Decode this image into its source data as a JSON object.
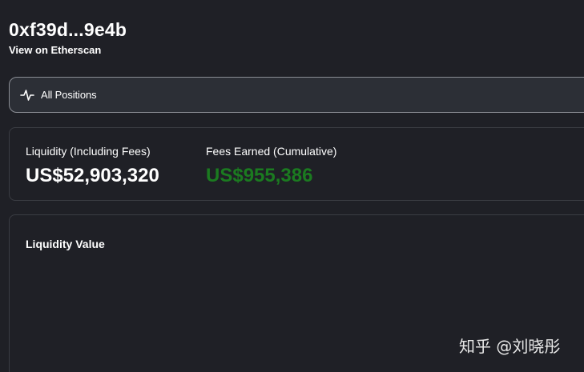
{
  "header": {
    "address": "0xf39d...9e4b",
    "etherscan_link": "View on Etherscan"
  },
  "positions_selector": {
    "icon": "pulse-icon",
    "label": "All Positions"
  },
  "stats": {
    "liquidity": {
      "label": "Liquidity (Including Fees)",
      "value": "US$52,903,320"
    },
    "fees": {
      "label": "Fees Earned (Cumulative)",
      "value": "US$955,386",
      "color": "#1b7b20"
    }
  },
  "chart": {
    "title": "Liquidity Value"
  },
  "watermark": {
    "text": "知乎 @刘晓彤"
  },
  "colors": {
    "background": "#1f2026",
    "panel": "#2c2f36",
    "border": "#3a3c43",
    "text": "#ffffff",
    "positive": "#1b7b20"
  }
}
